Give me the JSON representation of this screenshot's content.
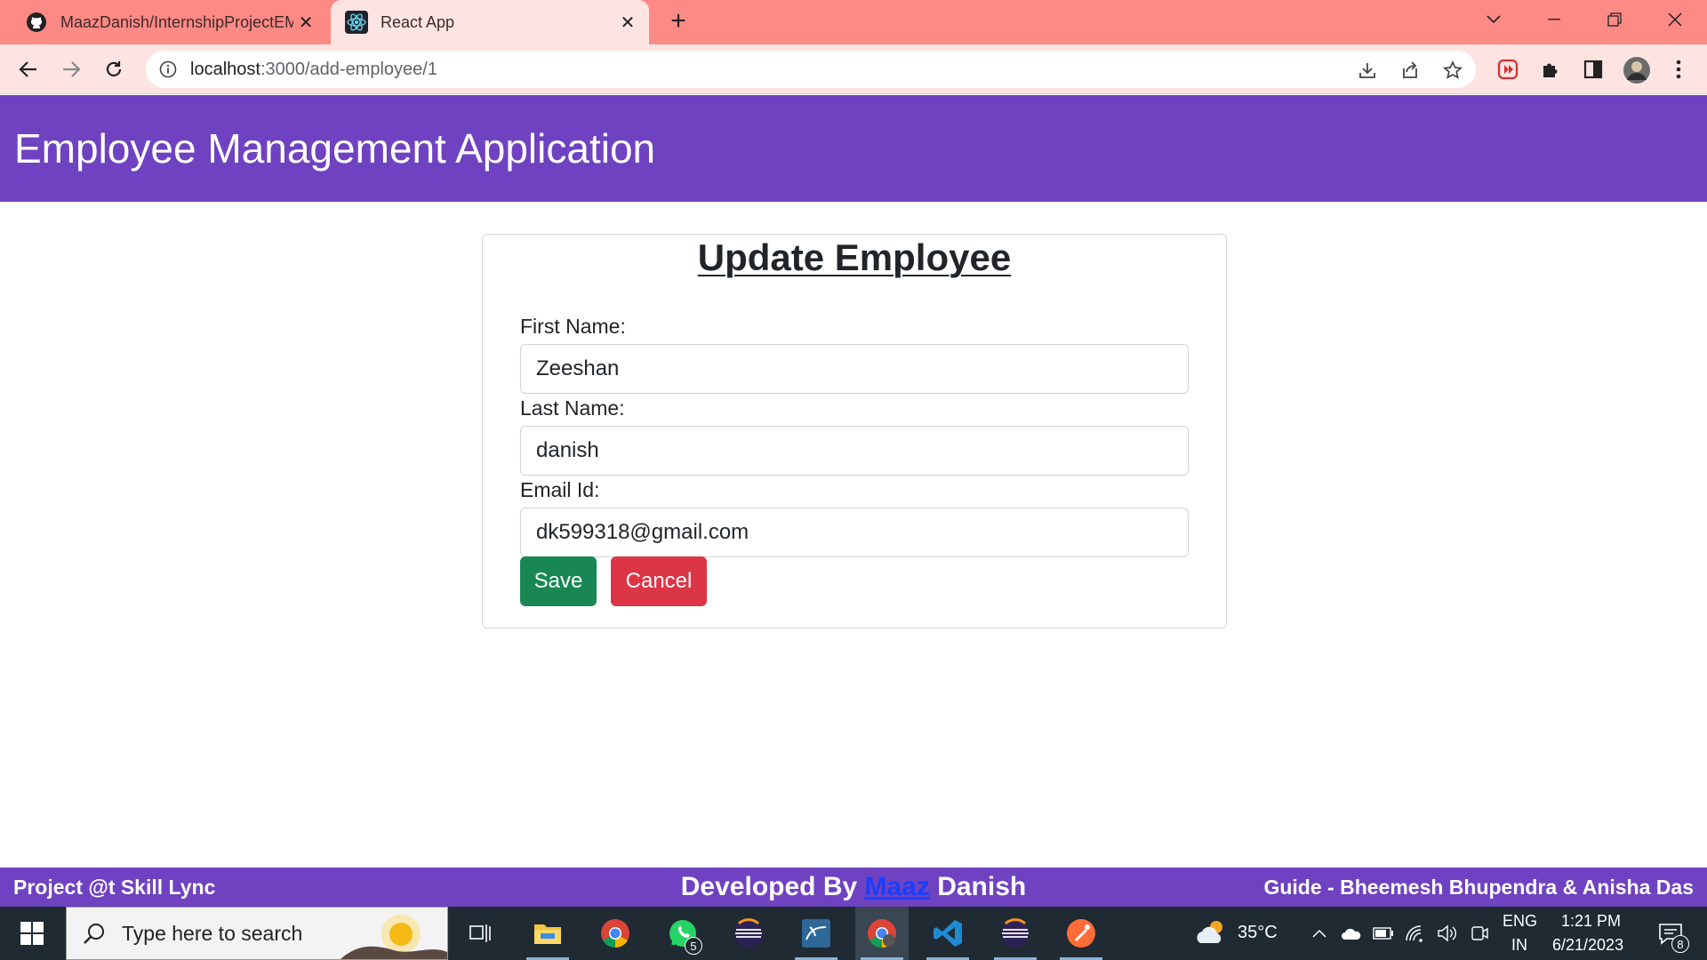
{
  "browser": {
    "tabs": [
      {
        "title": "MaazDanish/InternshipProjectEM",
        "icon": "github-icon"
      },
      {
        "title": "React App",
        "icon": "react-icon"
      }
    ],
    "url_host": "localhost",
    "url_path": ":3000/add-employee/1"
  },
  "app": {
    "header_title": "Employee Management Application",
    "form": {
      "title": "Update Employee",
      "first_name_label": "First Name:",
      "first_name_value": "Zeeshan",
      "last_name_label": "Last Name:",
      "last_name_value": "danish",
      "email_label": "Email Id:",
      "email_value": "dk599318@gmail.com",
      "save_label": "Save",
      "cancel_label": "Cancel"
    },
    "footer": {
      "left": "Project @t Skill Lync",
      "center_prefix": "Developed By ",
      "center_link": "Maaz",
      "center_suffix": " Danish",
      "right": "Guide - Bheemesh Bhupendra & Anisha Das"
    },
    "colors": {
      "header_bg": "#6f42c1",
      "save_bg": "#198754",
      "cancel_bg": "#dc3545",
      "tabbar_bg": "#fe8a86"
    }
  },
  "taskbar": {
    "search_placeholder": "Type here to search",
    "whatsapp_badge": "5",
    "weather": "35°C",
    "lang_top": "ENG",
    "lang_bottom": "IN",
    "time": "1:21 PM",
    "date": "6/21/2023",
    "notifications": "8"
  }
}
